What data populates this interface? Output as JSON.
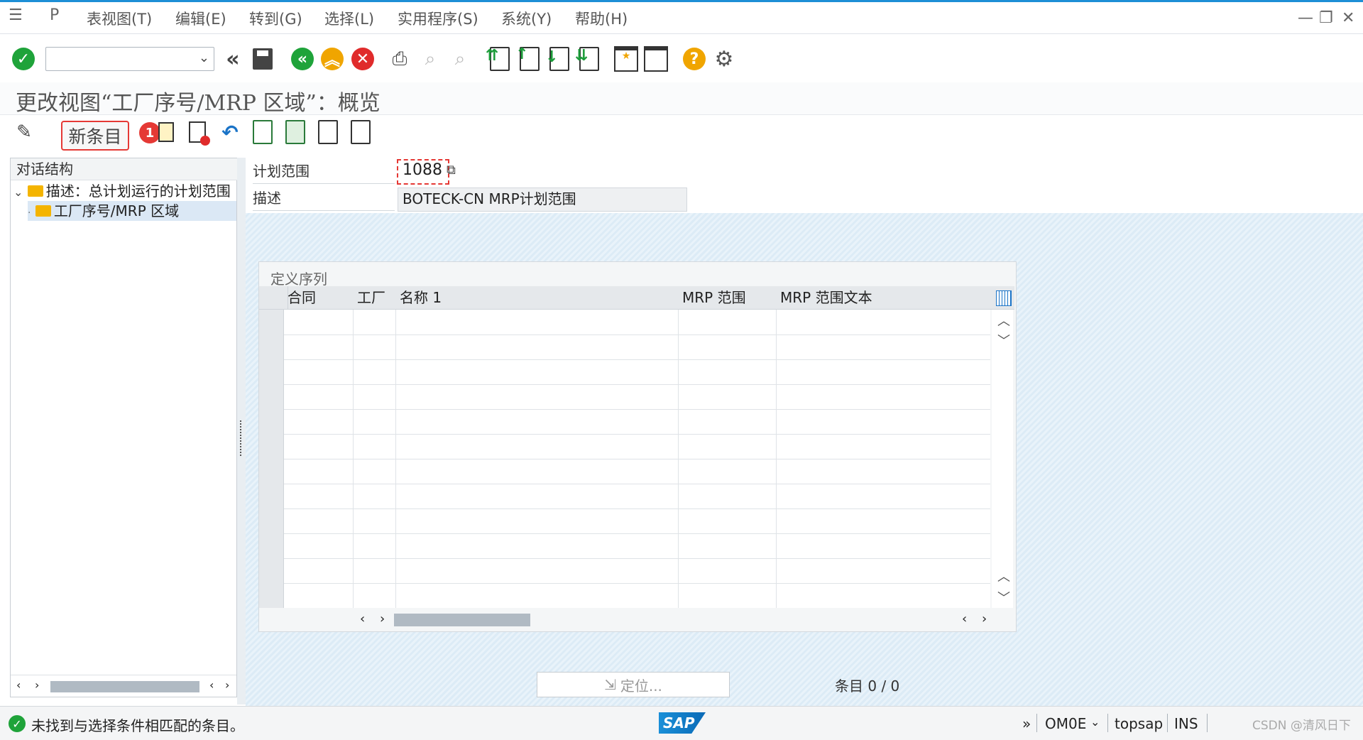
{
  "menu": {
    "items": [
      "表视图(T)",
      "编辑(E)",
      "转到(G)",
      "选择(L)",
      "实用程序(S)",
      "系统(Y)",
      "帮助(H)"
    ]
  },
  "toolbar": {
    "command_field_value": "",
    "icons": [
      "enter-icon",
      "back-double-icon",
      "save-icon",
      "back-icon",
      "exit-icon",
      "cancel-icon",
      "print-icon",
      "find-icon",
      "find-next-icon",
      "first-page-icon",
      "prev-page-icon",
      "next-page-icon",
      "last-page-icon",
      "new-session-icon",
      "shortcut-icon",
      "help-icon",
      "settings-icon"
    ]
  },
  "title": "更改视图“工厂序号/MRP 区域”：概览",
  "app_toolbar": {
    "new_entry_label": "新条目",
    "badge": "1"
  },
  "tree": {
    "header": "对话结构",
    "nodes": [
      {
        "label": "描述：总计划运行的计划范围"
      },
      {
        "label": "工厂序号/MRP 区域"
      }
    ]
  },
  "form": {
    "plan_scope_label": "计划范围",
    "plan_scope_value": "1088",
    "desc_label": "描述",
    "desc_value": "BOTECK-CN MRP计划范围"
  },
  "table": {
    "title": "定义序列",
    "columns": [
      "合同",
      "工厂",
      "名称 1",
      "MRP 范围",
      "MRP 范围文本"
    ],
    "rows": []
  },
  "position_button": "定位...",
  "entry_count": "条目 0 / 0",
  "status": {
    "message": "未找到与选择条件相匹配的条目。",
    "transaction": "OM0E",
    "server": "topsap",
    "mode": "INS",
    "watermark": "CSDN @清风日下"
  }
}
